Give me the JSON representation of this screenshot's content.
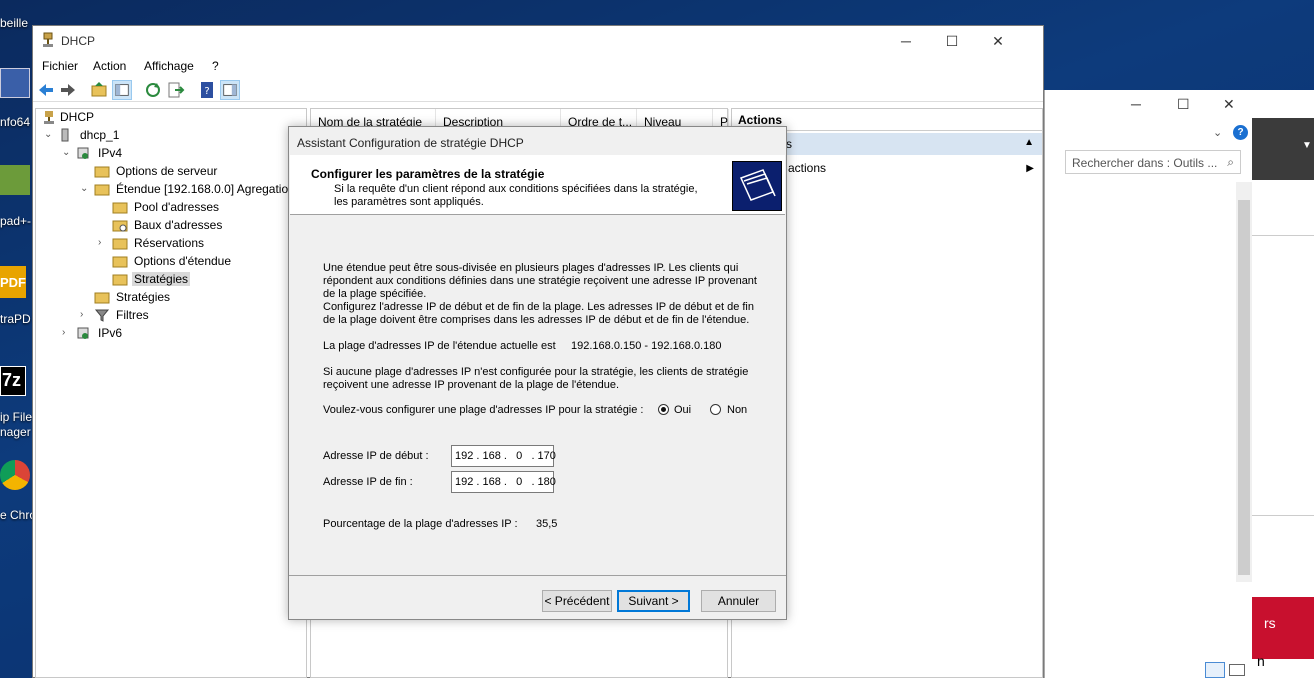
{
  "desktop": {
    "icons": [
      "beille",
      "nfo64",
      "pad+-",
      "traPD",
      "ip File",
      "nager",
      "e Chro"
    ],
    "glyphs": {
      "pdf": "PDF",
      "zip": "7z"
    }
  },
  "background_window": {
    "search_placeholder": "Rechercher dans : Outils ...",
    "red_label": "rs",
    "bottom_label": "n",
    "help": "?"
  },
  "window": {
    "title": "DHCP",
    "controls": {
      "minimize": "─",
      "maximize": "☐",
      "close": "✕"
    }
  },
  "menu": [
    "Fichier",
    "Action",
    "Affichage",
    "?"
  ],
  "tree": [
    {
      "label": "DHCP",
      "expander": ""
    },
    {
      "label": "dhcp_1",
      "expander": "⌄"
    },
    {
      "label": "IPv4",
      "expander": "⌄"
    },
    {
      "label": "Options de serveur",
      "expander": ""
    },
    {
      "label": "Étendue [192.168.0.0] Agregation",
      "expander": "⌄"
    },
    {
      "label": "Pool d'adresses",
      "expander": ""
    },
    {
      "label": "Baux d'adresses",
      "expander": ""
    },
    {
      "label": "Réservations",
      "expander": "›"
    },
    {
      "label": "Options d'étendue",
      "expander": ""
    },
    {
      "label": "Stratégies",
      "expander": ""
    },
    {
      "label": "Stratégies",
      "expander": ""
    },
    {
      "label": "Filtres",
      "expander": "›"
    },
    {
      "label": "IPv6",
      "expander": "›"
    }
  ],
  "list_columns": [
    "Nom de la stratégie",
    "Description",
    "Ordre de t...",
    "Niveau",
    "P"
  ],
  "actions": {
    "header": "Actions",
    "group": "s",
    "more": "es actions"
  },
  "wizard": {
    "title": "Assistant Configuration de stratégie DHCP",
    "heading": "Configurer les paramètres de la stratégie",
    "subheading": "Si la requête d'un client répond aux conditions spécifiées dans la stratégie, les paramètres sont appliqués.",
    "para1": "Une étendue peut être sous-divisée en plusieurs plages d'adresses IP. Les clients qui répondent aux conditions définies dans une stratégie reçoivent une adresse IP provenant de la plage spécifiée.",
    "para2": "Configurez l'adresse IP de début et de fin de la plage. Les adresses IP de début et de fin de la plage doivent être comprises dans les adresses IP de début et de fin de l'étendue.",
    "range_label": "La plage d'adresses IP de l'étendue actuelle est",
    "range_value": "192.168.0.150 - 192.168.0.180",
    "para3": "Si aucune plage d'adresses IP n'est configurée pour la stratégie, les clients de stratégie reçoivent une adresse IP provenant de la plage de l'étendue.",
    "question": "Voulez-vous configurer une plage d'adresses IP pour la stratégie :",
    "yes": "Oui",
    "no": "Non",
    "start_label": "Adresse IP de début :",
    "start_value": "192 . 168 .   0   . 170",
    "end_label": "Adresse IP de fin :",
    "end_value": "192 . 168 .   0   . 180",
    "percent_label": "Pourcentage de la plage d'adresses IP :",
    "percent_value": "35,5",
    "btn_prev": "< Précédent",
    "btn_next": "Suivant >",
    "btn_cancel": "Annuler"
  }
}
